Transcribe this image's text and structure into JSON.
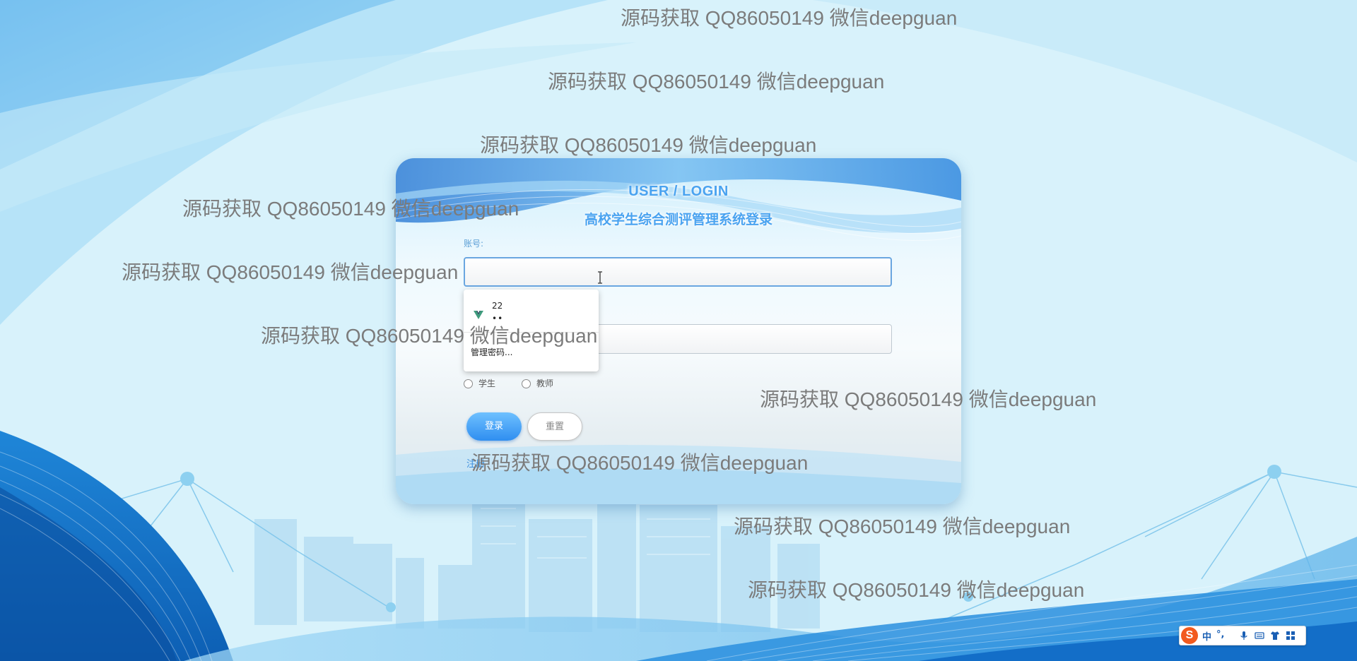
{
  "login": {
    "title_en": "USER / LOGIN",
    "title_cn": "高校学生综合测评管理系统登录",
    "account_label": "账号:",
    "account_value": "",
    "password_value": "",
    "roles": [
      "学生",
      "教师"
    ],
    "login_button": "登录",
    "reset_button": "重置",
    "register_link": "注册"
  },
  "autocomplete": {
    "username": "22",
    "password_mask": "••",
    "manage": "管理密码..."
  },
  "watermark": {
    "text": "源码获取 QQ86050149 微信deepguan"
  },
  "ime": {
    "logo": "S",
    "mode": "中",
    "punct": "°,"
  },
  "colors": {
    "accent": "#2f8ef0",
    "title": "#4aa3f0",
    "ime_logo": "#f25a1e"
  }
}
